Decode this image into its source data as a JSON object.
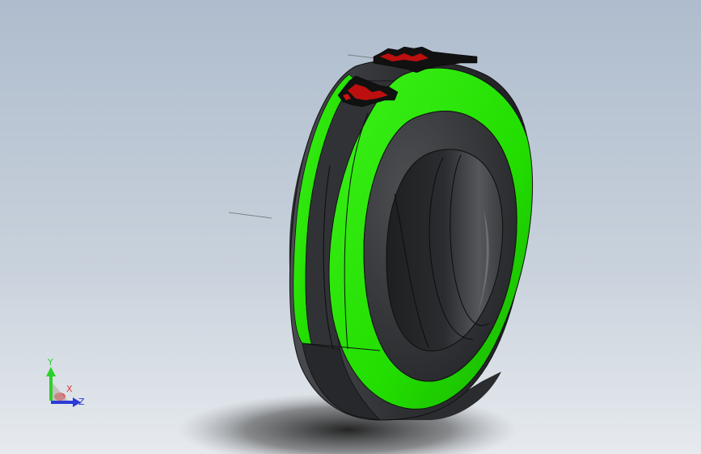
{
  "view": {
    "background_top": "#aebccd",
    "background_bottom": "#e6eaee"
  },
  "model": {
    "name": "tire",
    "rubber_color": "#333538",
    "accent_color": "#22dd00",
    "decal_color": "#d01010",
    "edge_color": "#111111"
  },
  "triad": {
    "y_label": "Y",
    "x_label": "X",
    "z_label": "Z",
    "y_color": "#2bd12b",
    "x_color": "#e23a3a",
    "z_color": "#2a3bd6"
  }
}
